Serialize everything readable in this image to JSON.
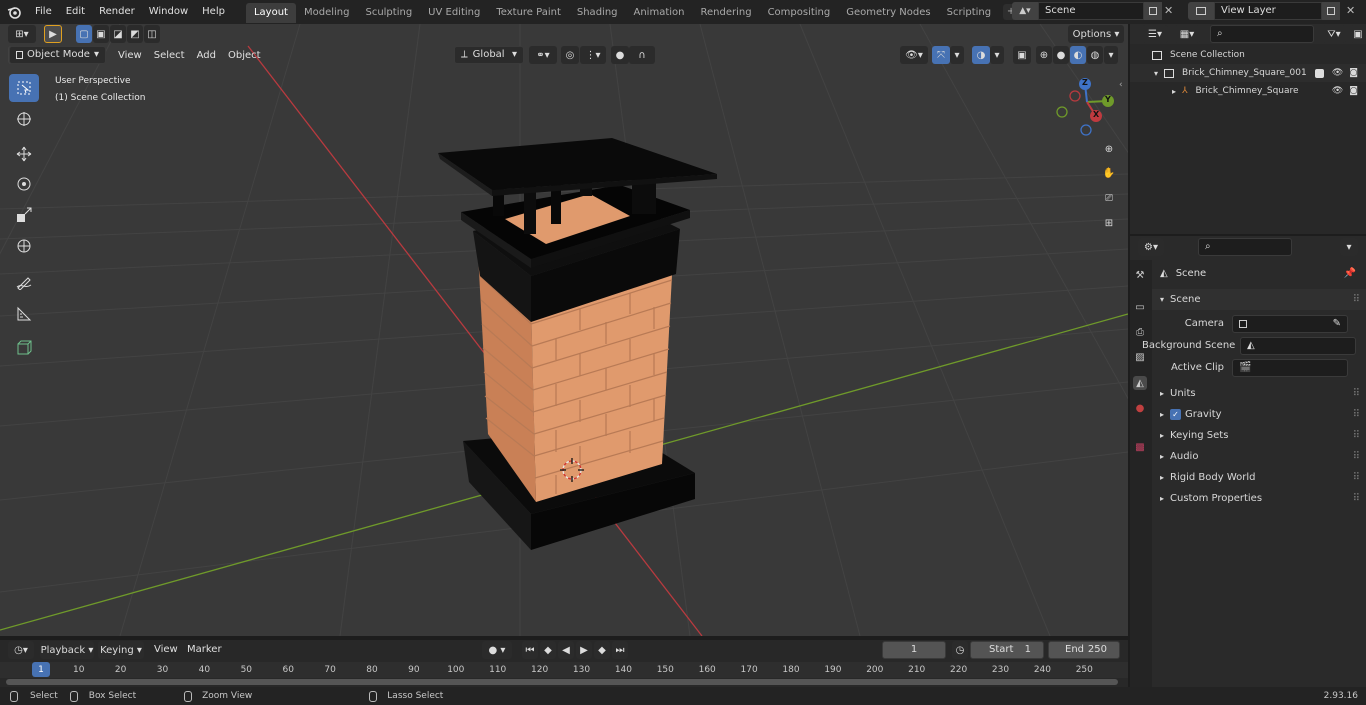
{
  "topbar": {
    "menus": [
      "File",
      "Edit",
      "Render",
      "Window",
      "Help"
    ],
    "workspaces": [
      "Layout",
      "Modeling",
      "Sculpting",
      "UV Editing",
      "Texture Paint",
      "Shading",
      "Animation",
      "Rendering",
      "Compositing",
      "Geometry Nodes",
      "Scripting"
    ],
    "active_workspace": "Layout",
    "scene_name": "Scene",
    "view_layer": "View Layer"
  },
  "viewport": {
    "mode": "Object Mode",
    "menus": [
      "View",
      "Select",
      "Add",
      "Object"
    ],
    "transform_orientation": "Global",
    "options_label": "Options",
    "overlay_title": "User Perspective",
    "overlay_sub": "(1) Scene Collection",
    "gizmo_axes": {
      "x": "X",
      "y": "Y",
      "z": "Z"
    }
  },
  "outliner": {
    "scene_collection": "Scene Collection",
    "collection": "Brick_Chimney_Square_001",
    "object": "Brick_Chimney_Square"
  },
  "properties": {
    "context_title": "Scene",
    "panel_title": "Scene",
    "fields": {
      "camera": "Camera",
      "background_scene": "Background Scene",
      "active_clip": "Active Clip"
    },
    "sections": [
      "Units",
      "Gravity",
      "Keying Sets",
      "Audio",
      "Rigid Body World",
      "Custom Properties"
    ],
    "gravity_checked": true
  },
  "timeline": {
    "menus": [
      "Playback",
      "Keying",
      "View",
      "Marker"
    ],
    "current_frame": "1",
    "start_label": "Start",
    "start_value": "1",
    "end_label": "End",
    "end_value": "250",
    "ticks": [
      "1",
      "10",
      "20",
      "30",
      "40",
      "50",
      "60",
      "70",
      "80",
      "90",
      "100",
      "110",
      "120",
      "130",
      "140",
      "150",
      "160",
      "170",
      "180",
      "190",
      "200",
      "210",
      "220",
      "230",
      "240",
      "250"
    ]
  },
  "statusbar": {
    "select": "Select",
    "box_select": "Box Select",
    "zoom_view": "Zoom View",
    "lasso_select": "Lasso Select",
    "version": "2.93.16"
  },
  "colors": {
    "accent": "#4772b3",
    "x_axis": "#b83a3f",
    "y_axis": "#6f9a2a",
    "brick": "#d9936a"
  }
}
